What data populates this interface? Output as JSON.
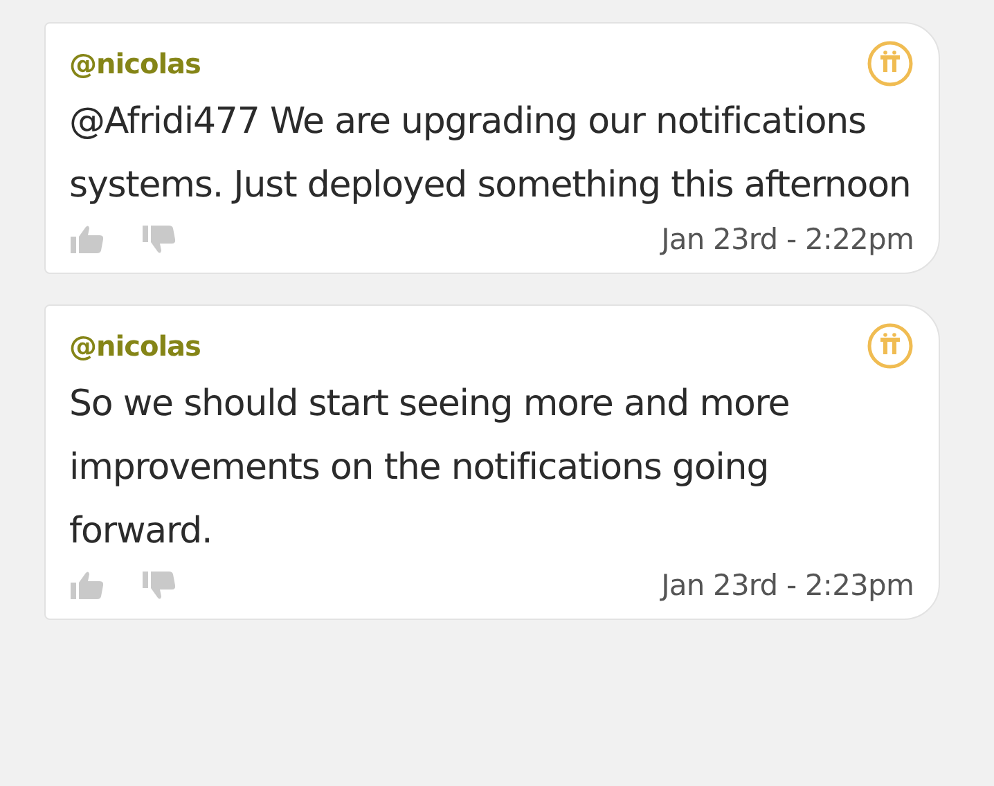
{
  "messages": [
    {
      "author": "@nicolas",
      "text": "@Afridi477 We are upgrading our notifications systems. Just deployed something this afternoon",
      "time": "Jan 23rd - 2:22pm"
    },
    {
      "author": "@nicolas",
      "text": "So we should start seeing more and more improvements on the notifications going forward.",
      "time": "Jan 23rd - 2:23pm"
    }
  ]
}
